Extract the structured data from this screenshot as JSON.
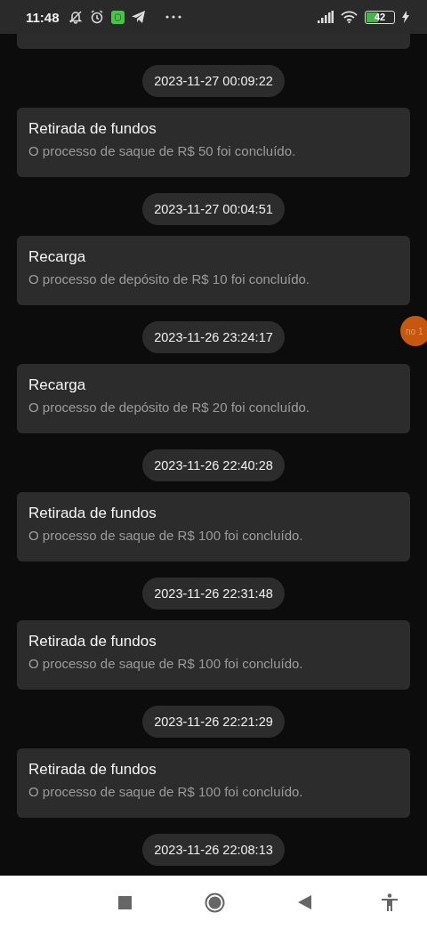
{
  "status_bar": {
    "time": "11:48",
    "battery": "42"
  },
  "entries": [
    {
      "timestamp": "2023-11-27 00:09:22",
      "title": "Retirada de fundos",
      "message": "O processo de saque de R$ 50 foi concluído."
    },
    {
      "timestamp": "2023-11-27 00:04:51",
      "title": "Recarga",
      "message": "O processo de depósito de R$ 10 foi concluído."
    },
    {
      "timestamp": "2023-11-26 23:24:17",
      "title": "Recarga",
      "message": "O processo de depósito de R$ 20 foi concluído."
    },
    {
      "timestamp": "2023-11-26 22:40:28",
      "title": "Retirada de fundos",
      "message": "O processo de saque de R$ 100 foi concluído."
    },
    {
      "timestamp": "2023-11-26 22:31:48",
      "title": "Retirada de fundos",
      "message": "O processo de saque de R$ 100 foi concluído."
    },
    {
      "timestamp": "2023-11-26 22:21:29",
      "title": "Retirada de fundos",
      "message": "O processo de saque de R$ 100 foi concluído."
    },
    {
      "timestamp": "2023-11-26 22:08:13"
    }
  ],
  "floating_button": {
    "label": "no 1"
  }
}
